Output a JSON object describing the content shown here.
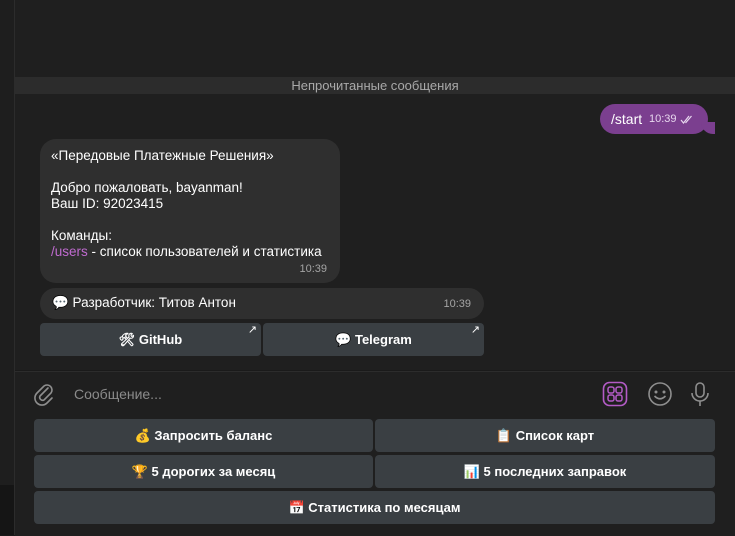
{
  "chat": {
    "unread_divider": "Непрочитанные сообщения",
    "outgoing": {
      "text": "/start",
      "time": "10:39"
    },
    "incoming": {
      "line1": "«Передовые Платежные Решения»",
      "line2": "Добро пожаловать, bayanman!",
      "line3": "Ваш ID: 92023415",
      "line4": "Команды:",
      "command": "/users",
      "command_desc": " - список пользователей и статистика",
      "time": "10:39"
    },
    "developer": {
      "text": "💬 Разработчик: Титов Антон",
      "time": "10:39"
    },
    "inline_buttons": [
      {
        "label": "🛠 GitHub",
        "arrow": "↗"
      },
      {
        "label": "💬 Telegram",
        "arrow": "↗"
      }
    ]
  },
  "composer": {
    "placeholder": "Сообщение..."
  },
  "keyboard": {
    "row1": [
      "💰 Запросить баланс",
      "📋 Список карт"
    ],
    "row2": [
      "🏆 5 дорогих за месяц",
      "📊 5 последних заправок"
    ],
    "row3": [
      "📅 Статистика по месяцам"
    ]
  },
  "colors": {
    "accent": "#7b3f8f",
    "link": "#c06bd0",
    "bubble": "#2f2f2f",
    "button": "#3a3f43"
  },
  "icons": [
    "double-check-icon",
    "paperclip-icon",
    "keyboard-toggle-icon",
    "emoji-icon",
    "microphone-icon",
    "external-link-icon"
  ]
}
